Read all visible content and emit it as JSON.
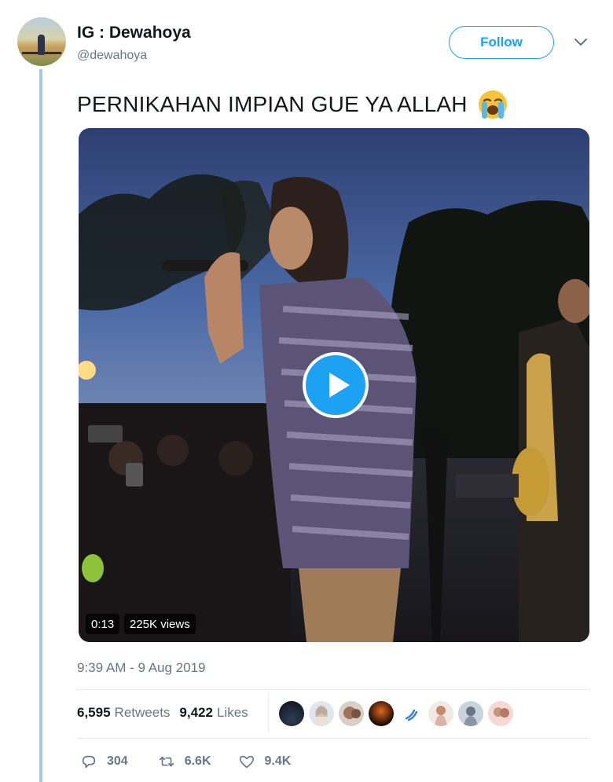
{
  "tweet": {
    "author_name": "IG : Dewahoya",
    "author_handle": "@dewahoya",
    "follow_label": "Follow",
    "text": "PERNIKAHAN IMPIAN GUE YA ALLAH",
    "emoji": "loudly-crying-face",
    "timestamp": "9:39 AM - 9 Aug 2019"
  },
  "video": {
    "duration": "0:13",
    "views": "225K views"
  },
  "stats": {
    "retweets_count": "6,595",
    "retweets_label": "Retweets",
    "likes_count": "9,422",
    "likes_label": "Likes"
  },
  "likers": [
    "dark-blue",
    "hijab",
    "selfie",
    "orange-dark",
    "blue-logo",
    "light-figure",
    "grey-portrait",
    "pink-selfie"
  ],
  "actions": {
    "replies": "304",
    "retweets": "6.6K",
    "likes": "9.4K"
  },
  "colors": {
    "accent": "#1da1f2",
    "secondary_text": "#657786",
    "thread_line": "#a8c9e4"
  }
}
